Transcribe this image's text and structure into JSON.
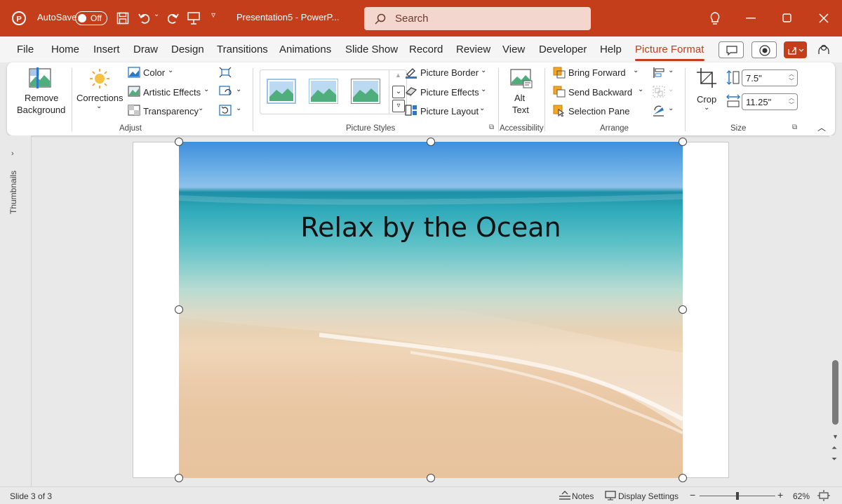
{
  "titlebar": {
    "autosave_label": "AutoSave",
    "autosave_state": "Off",
    "doc_title": "Presentation5  -  PowerP...",
    "search_placeholder": "Search"
  },
  "tabs": [
    "File",
    "Home",
    "Insert",
    "Draw",
    "Design",
    "Transitions",
    "Animations",
    "Slide Show",
    "Record",
    "Review",
    "View",
    "Developer",
    "Help",
    "Picture Format"
  ],
  "active_tab": "Picture Format",
  "ribbon": {
    "adjust": {
      "remove_bg_line1": "Remove",
      "remove_bg_line2": "Background",
      "corrections": "Corrections",
      "color": "Color",
      "artistic_effects": "Artistic Effects",
      "transparency": "Transparency",
      "group_label": "Adjust"
    },
    "picture_styles": {
      "picture_border": "Picture Border",
      "picture_effects": "Picture Effects",
      "picture_layout": "Picture Layout",
      "group_label": "Picture Styles"
    },
    "accessibility": {
      "alt_line1": "Alt",
      "alt_line2": "Text",
      "group_label": "Accessibility"
    },
    "arrange": {
      "bring_forward": "Bring Forward",
      "send_backward": "Send Backward",
      "selection_pane": "Selection Pane",
      "group_label": "Arrange"
    },
    "size": {
      "crop": "Crop",
      "height": "7.5\"",
      "width": "11.25\"",
      "group_label": "Size"
    }
  },
  "thumbnails_label": "Thumbnails",
  "slide": {
    "title": "Relax by the Ocean"
  },
  "status": {
    "slide_counter": "Slide 3 of 3",
    "notes": "Notes",
    "display_settings": "Display Settings",
    "zoom": "62%",
    "zoom_level": 0.5
  },
  "colors": {
    "accent": "#c43e1c",
    "ribbon_bg": "#ffffff",
    "app_bg": "#e9e9e9"
  }
}
